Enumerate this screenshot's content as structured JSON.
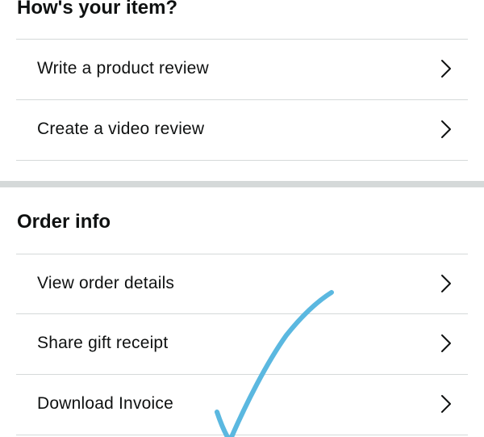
{
  "sections": [
    {
      "title": "How's your item?",
      "items": [
        {
          "label": "Write a product review"
        },
        {
          "label": "Create a video review"
        }
      ]
    },
    {
      "title": "Order info",
      "items": [
        {
          "label": "View order details"
        },
        {
          "label": "Share gift receipt"
        },
        {
          "label": "Download Invoice"
        }
      ]
    }
  ],
  "colors": {
    "text": "#0f1111",
    "divider": "#d5d9d9",
    "annotation_check": "#5bb8e0"
  },
  "icons": {
    "row_arrow": "chevron-right-icon",
    "annotation": "checkmark-icon"
  }
}
